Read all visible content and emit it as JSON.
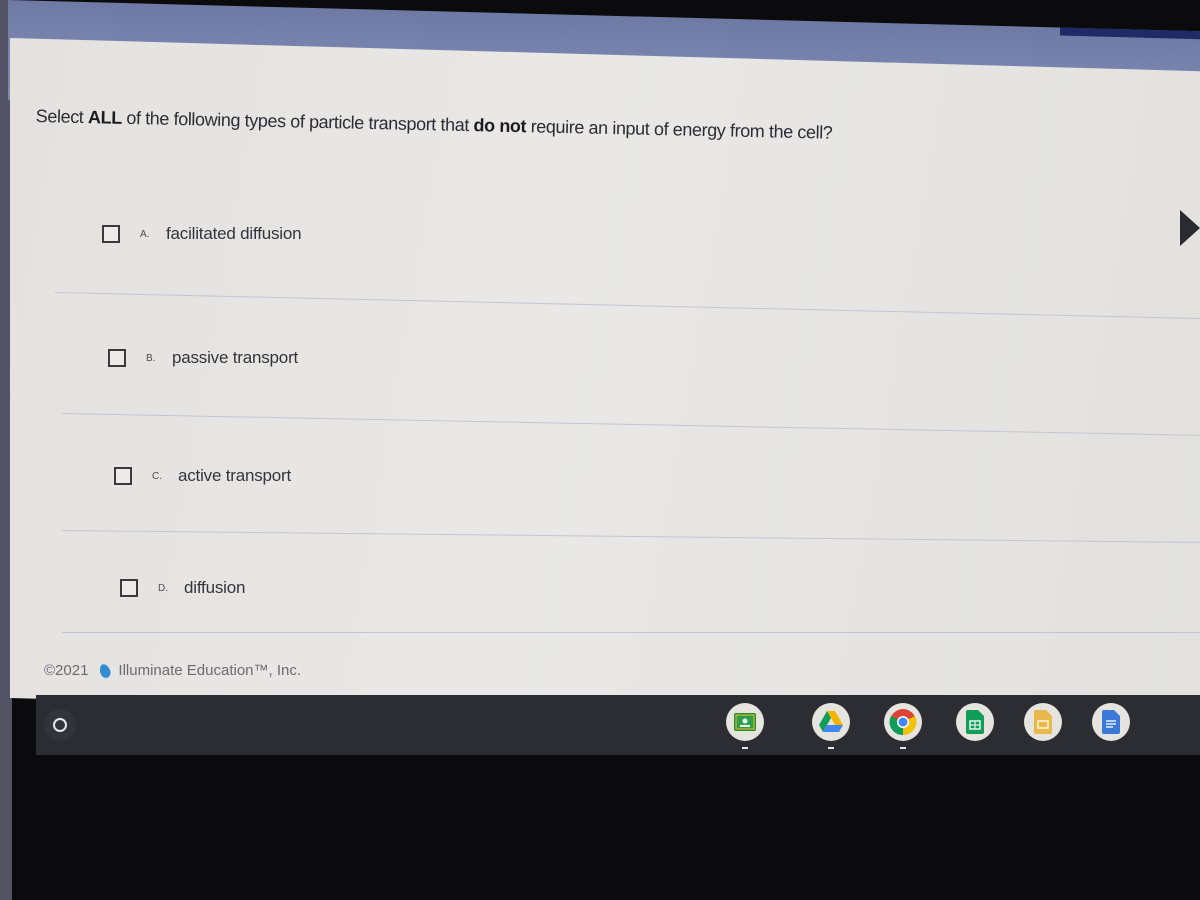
{
  "question": {
    "prefix": "Select ",
    "bold1": "ALL",
    "middle": " of the following types of particle transport that ",
    "bold2": "do not",
    "suffix": " require an input of energy from the cell?"
  },
  "options": [
    {
      "letter": "A.",
      "text": "facilitated diffusion",
      "checked": false
    },
    {
      "letter": "B.",
      "text": "passive transport",
      "checked": false
    },
    {
      "letter": "C.",
      "text": "active transport",
      "checked": false
    },
    {
      "letter": "D.",
      "text": "diffusion",
      "checked": false
    }
  ],
  "footer": {
    "copyright": "©2021",
    "company": "Illuminate Education™, Inc."
  },
  "shelf": {
    "launcher": "launcher-icon",
    "apps": [
      {
        "name": "google-classroom",
        "icon": "classroom-icon",
        "color": "#2e8b57"
      },
      {
        "name": "google-drive",
        "icon": "drive-icon",
        "color": "#f4b400"
      },
      {
        "name": "google-chrome",
        "icon": "chrome-icon",
        "color": "#4285f4"
      },
      {
        "name": "google-sheets",
        "icon": "sheets-icon",
        "color": "#0f9d58"
      },
      {
        "name": "google-slides",
        "icon": "slides-icon",
        "color": "#f4b400"
      },
      {
        "name": "google-docs",
        "icon": "docs-icon",
        "color": "#4285f4"
      }
    ]
  }
}
